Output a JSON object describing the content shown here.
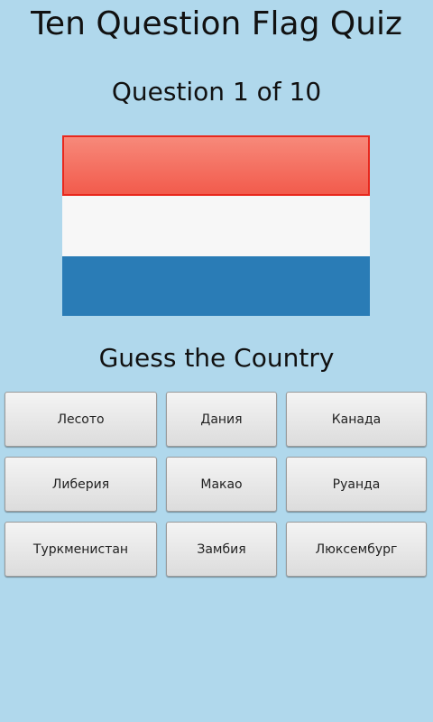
{
  "app": {
    "title": "Ten Question Flag Quiz"
  },
  "quiz": {
    "question_label": "Question 1 of 10",
    "prompt": "Guess the Country",
    "flag": {
      "stripes": [
        "#f25b4c",
        "#f7f7f7",
        "#2a7cb6"
      ]
    },
    "answers": [
      "Лесото",
      "Дания",
      "Канада",
      "Либерия",
      "Макао",
      "Руанда",
      "Туркменистан",
      "Замбия",
      "Люксембург"
    ]
  },
  "colors": {
    "background": "#b0d8ec"
  }
}
